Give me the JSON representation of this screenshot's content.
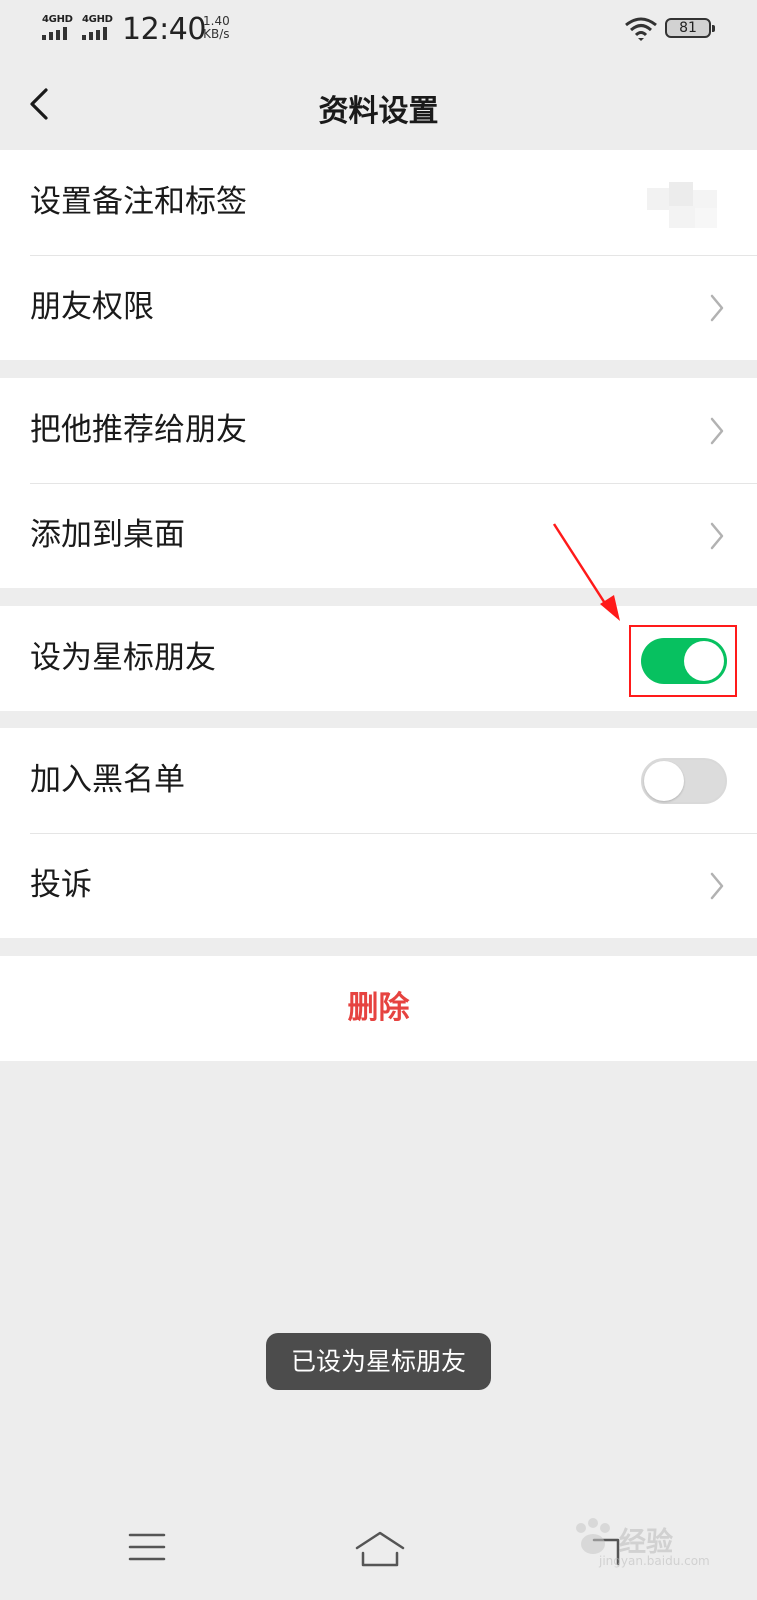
{
  "status_bar": {
    "sim1": "4GHD",
    "sim2": "4GHD",
    "time": "12:40",
    "speed_value": "1.40",
    "speed_unit": "KB/s",
    "battery": "81"
  },
  "nav": {
    "title": "资料设置"
  },
  "groups": [
    {
      "rows": [
        {
          "label": "设置备注和标签"
        },
        {
          "label": "朋友权限"
        }
      ]
    },
    {
      "rows": [
        {
          "label": "把他推荐给朋友"
        },
        {
          "label": "添加到桌面"
        }
      ]
    },
    {
      "rows": [
        {
          "label": "设为星标朋友",
          "toggle_on": true
        }
      ]
    },
    {
      "rows": [
        {
          "label": "加入黑名单",
          "toggle_on": false
        },
        {
          "label": "投诉"
        }
      ]
    }
  ],
  "delete_label": "删除",
  "toast": "已设为星标朋友",
  "colors": {
    "accent": "#07c160",
    "danger": "#e64340",
    "annotation": "#ff1a1a",
    "background": "#ededed"
  },
  "watermark": {
    "text": "经验",
    "url": "jingyan.baidu.com"
  }
}
